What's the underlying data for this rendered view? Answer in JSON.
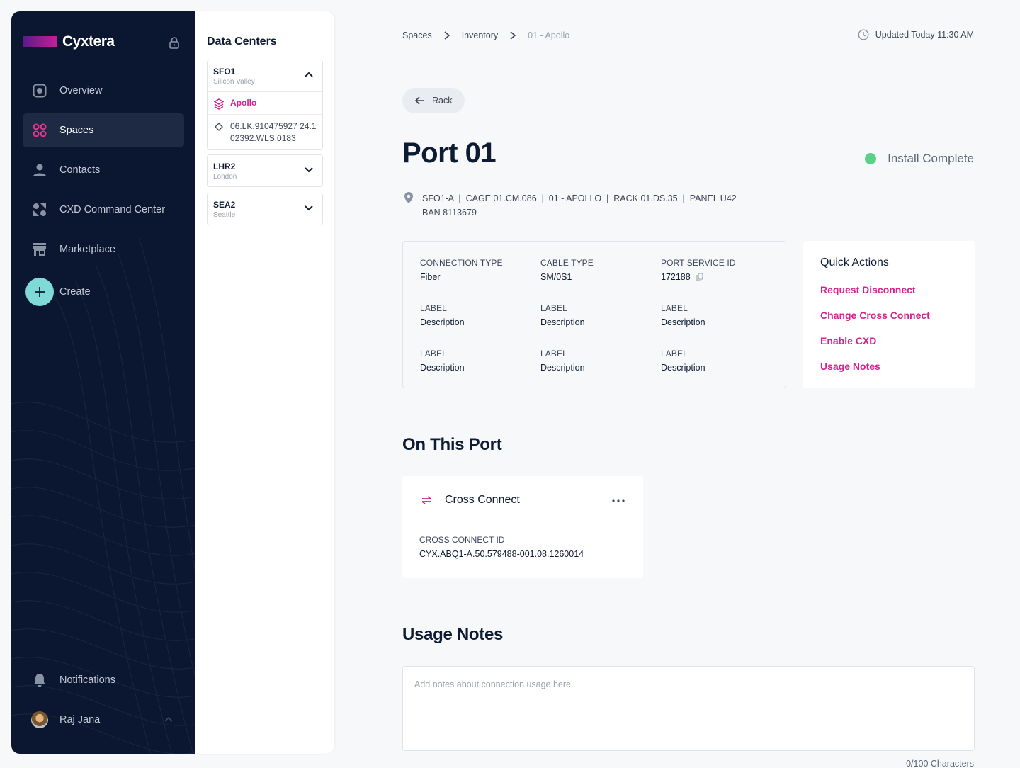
{
  "sidebar": {
    "brand": "Cyxtera",
    "nav": [
      {
        "label": "Overview",
        "icon": "overview-icon"
      },
      {
        "label": "Spaces",
        "icon": "spaces-icon",
        "active": true
      },
      {
        "label": "Contacts",
        "icon": "contact-icon"
      },
      {
        "label": "CXD Command Center",
        "icon": "command-center-icon"
      },
      {
        "label": "Marketplace",
        "icon": "store-icon"
      }
    ],
    "create_label": "Create",
    "notifications_label": "Notifications",
    "user_name": "Raj Jana"
  },
  "data_centers": {
    "title": "Data Centers",
    "items": [
      {
        "code": "SFO1",
        "city": "Silicon Valley",
        "expanded": true,
        "children": [
          {
            "label": "Apollo",
            "icon": "layers-icon",
            "selected": true
          },
          {
            "label": "06.LK.910475927 24.102392.WLS.0183",
            "line1": "06.LK.910475927 24.1",
            "line2": "02392.WLS.0183",
            "icon": "diamond-icon"
          }
        ]
      },
      {
        "code": "LHR2",
        "city": "London",
        "expanded": false
      },
      {
        "code": "SEA2",
        "city": "Seattle",
        "expanded": false
      }
    ]
  },
  "breadcrumb": [
    "Spaces",
    "Inventory",
    "01 - Apollo"
  ],
  "updated": "Updated Today 11:30 AM",
  "back_label": "Rack",
  "title": "Port 01",
  "status": {
    "label": "Install Complete",
    "color": "#58d28a"
  },
  "location": {
    "line1": "SFO1-A  |  CAGE 01.CM.086  |  01 - APOLLO  |  RACK 01.DS.35  |  PANEL U42",
    "line2": "BAN 8113679"
  },
  "details": [
    {
      "label": "CONNECTION TYPE",
      "value": "Fiber"
    },
    {
      "label": "CABLE TYPE",
      "value": "SM/0S1"
    },
    {
      "label": "PORT SERVICE ID",
      "value": "172188",
      "copy": true
    },
    {
      "label": "LABEL",
      "value": "Description"
    },
    {
      "label": "LABEL",
      "value": "Description"
    },
    {
      "label": "LABEL",
      "value": "Description"
    },
    {
      "label": "LABEL",
      "value": "Description"
    },
    {
      "label": "LABEL",
      "value": "Description"
    },
    {
      "label": "LABEL",
      "value": "Description"
    }
  ],
  "quick_actions": {
    "title": "Quick Actions",
    "links": [
      "Request Disconnect",
      "Change Cross Connect",
      "Enable CXD",
      "Usage Notes"
    ]
  },
  "on_this_port": {
    "title": "On This Port",
    "card_title": "Cross Connect",
    "id_label": "CROSS CONNECT ID",
    "id_value": "CYX.ABQ1-A.50.579488-001.08.1260014"
  },
  "usage_notes": {
    "title": "Usage Notes",
    "placeholder": "Add notes about connection usage here",
    "counter": "0/100 Characters"
  },
  "colors": {
    "accent": "#d6248f",
    "sidebar_bg": "#0b1730",
    "create": "#7fd9d6"
  }
}
